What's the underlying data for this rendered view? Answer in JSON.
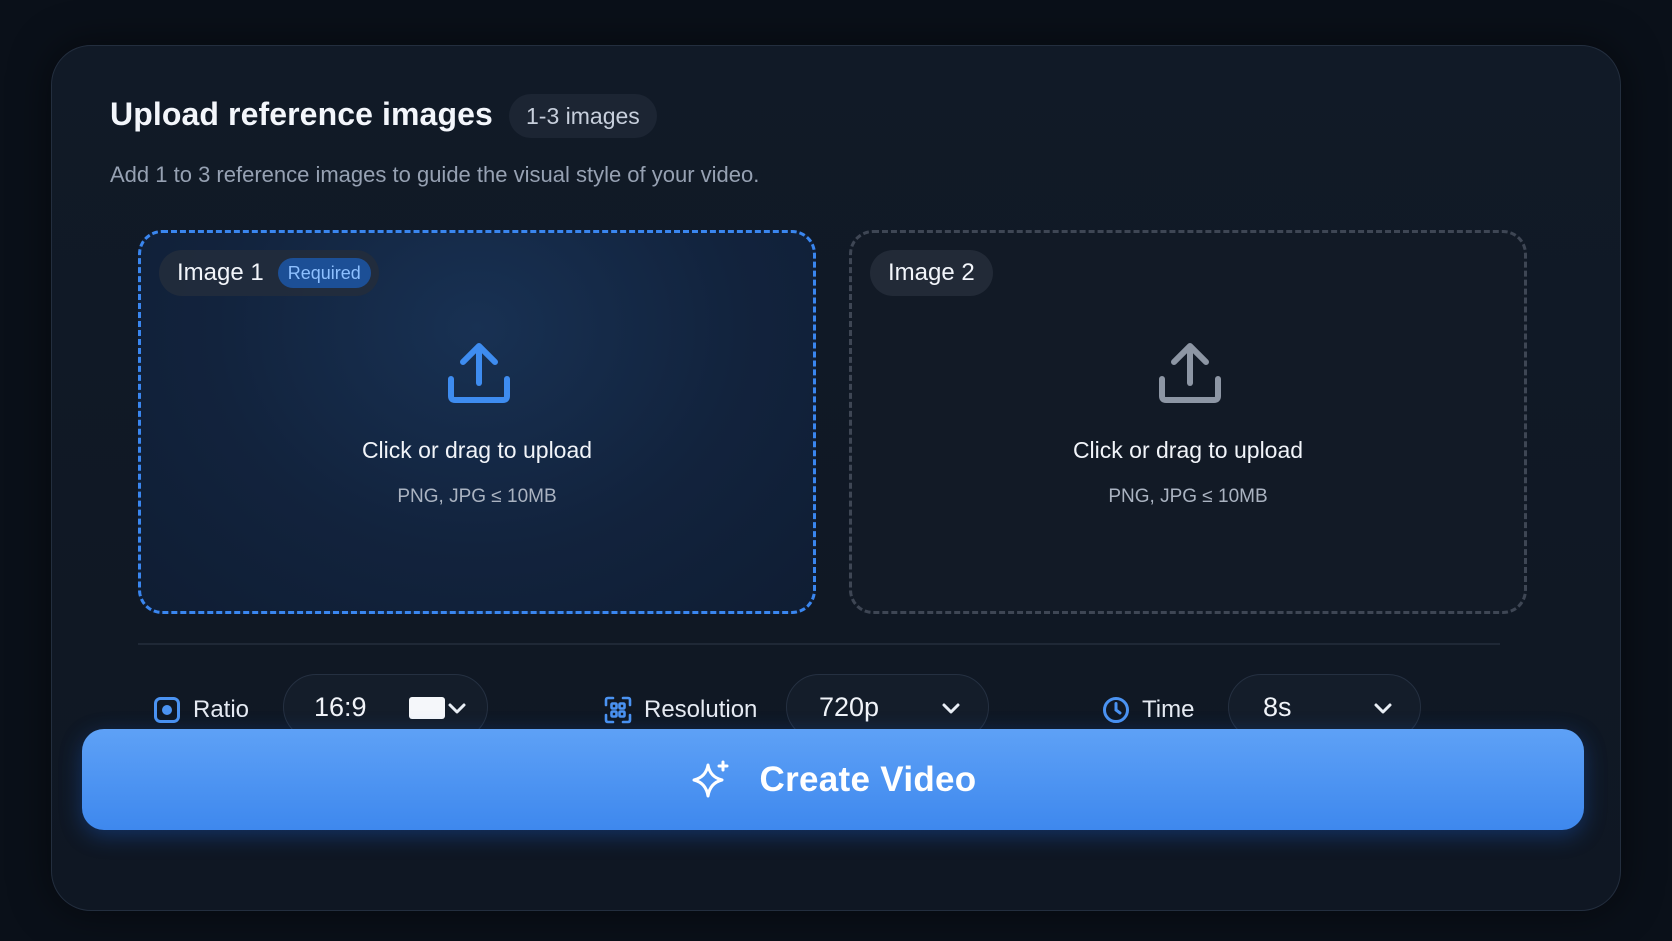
{
  "header": {
    "title": "Upload reference images",
    "count_badge": "1-3 images",
    "subtitle": "Add 1 to 3 reference images to guide the visual style of your video."
  },
  "dropzones": [
    {
      "label": "Image 1",
      "badge": "Required",
      "main_text": "Click or drag to upload",
      "hint": "PNG, JPG ≤ 10MB",
      "icon": "upload-icon",
      "state": "active"
    },
    {
      "label": "Image 2",
      "main_text": "Click or drag to upload",
      "hint": "PNG, JPG ≤ 10MB",
      "icon": "upload-icon",
      "state": "idle"
    }
  ],
  "options": {
    "ratio": {
      "label": "Ratio",
      "icon": "ratio-icon",
      "value": "16:9"
    },
    "resolution": {
      "label": "Resolution",
      "icon": "resolution-icon",
      "value": "720p"
    },
    "time": {
      "label": "Time",
      "icon": "clock-icon",
      "value": "8s"
    }
  },
  "cta": {
    "label": "Create Video",
    "icon": "sparkle-icon"
  },
  "colors": {
    "accent": "#3e88ee",
    "accent_light": "#5ea1f6",
    "background": "#0a1019",
    "card": "#111a27",
    "badge_bg": "#1c4f96",
    "badge_text": "#8ec0ff"
  }
}
